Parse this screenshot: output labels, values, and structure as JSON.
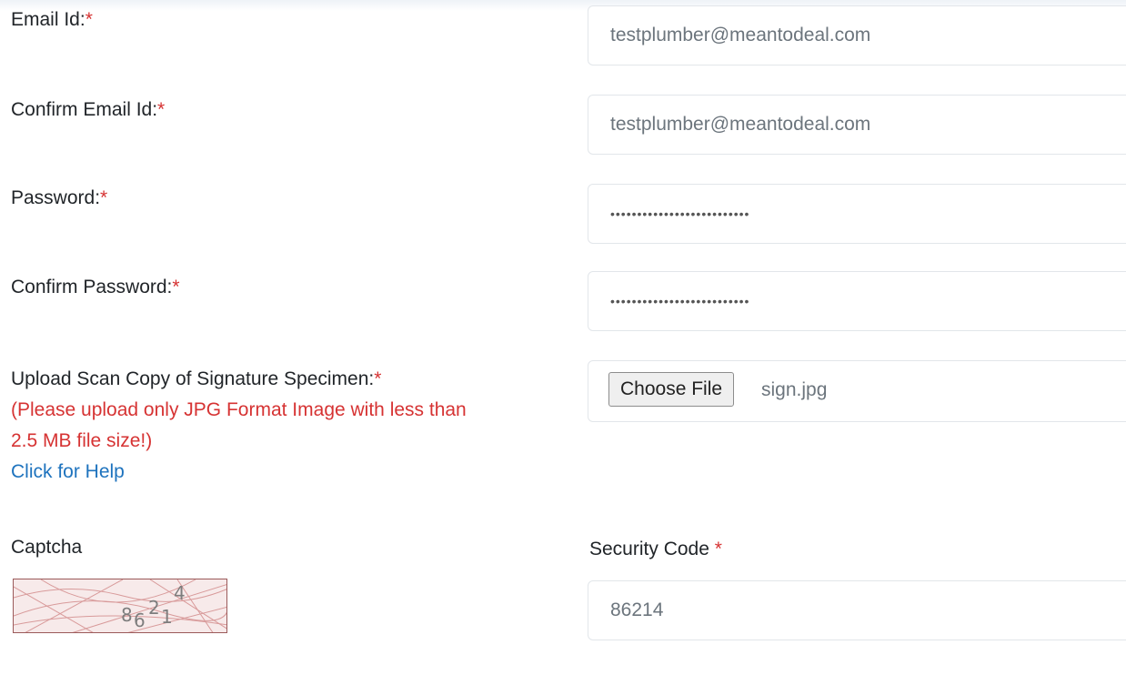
{
  "form": {
    "email": {
      "label": "Email Id:",
      "required_mark": "*",
      "value": "testplumber@meantodeal.com"
    },
    "confirm_email": {
      "label": "Confirm Email Id:",
      "required_mark": "*",
      "value": "testplumber@meantodeal.com"
    },
    "password": {
      "label": "Password:",
      "required_mark": "*",
      "masked_value": "••••••••••••••••••••••••••"
    },
    "confirm_password": {
      "label": "Confirm Password:",
      "required_mark": "*",
      "masked_value": "••••••••••••••••••••••••••"
    },
    "signature": {
      "label": "Upload Scan Copy of Signature Specimen:",
      "required_mark": "*",
      "note_line1": "(Please upload only JPG Format Image with less than",
      "note_line2": "2.5 MB file size!)",
      "help_link": "Click for Help",
      "button_label": "Choose File",
      "file_name": "sign.jpg"
    },
    "captcha": {
      "label": "Captcha",
      "code_digits": [
        "8",
        "6",
        "2",
        "1",
        "4"
      ]
    },
    "security_code": {
      "label": "Security Code ",
      "required_mark": "*",
      "value": "86214"
    }
  },
  "colors": {
    "required": "#d63333",
    "link": "#1e73be",
    "input_text": "#6c757d"
  }
}
